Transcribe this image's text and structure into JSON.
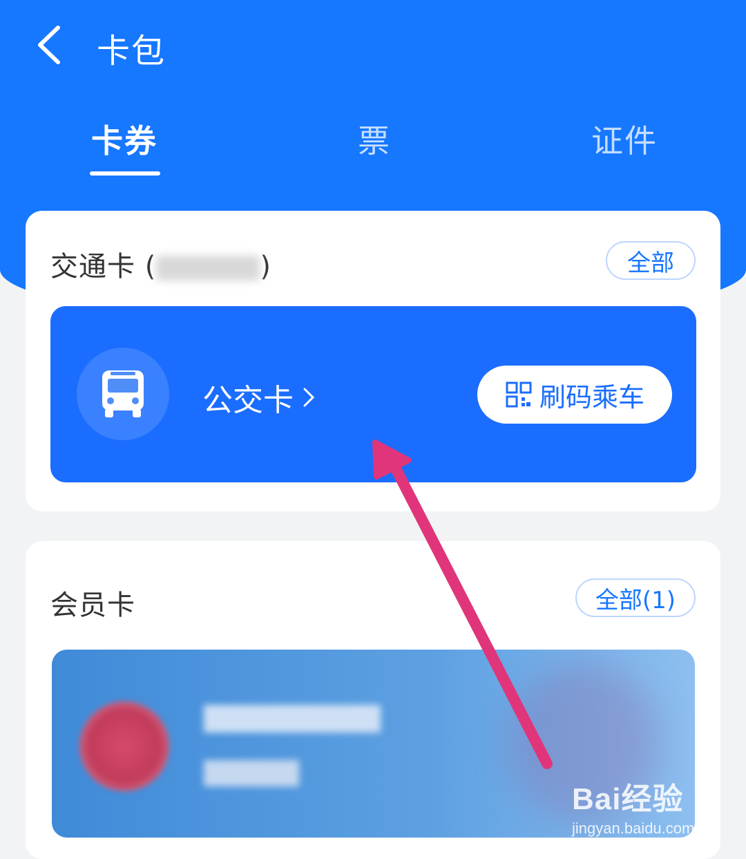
{
  "header": {
    "title": "卡包"
  },
  "tabs": [
    {
      "label": "卡券",
      "active": true
    },
    {
      "label": "票",
      "active": false
    },
    {
      "label": "证件",
      "active": false
    }
  ],
  "transit_section": {
    "title": "交通卡 (",
    "title_suffix": ")",
    "all_label": "全部",
    "card": {
      "label": "公交卡",
      "chevron": "›",
      "ride_button": "刷码乘车",
      "icon": "bus-icon"
    }
  },
  "member_section": {
    "title": "会员卡",
    "all_label": "全部(1)"
  },
  "watermark": {
    "logo": "Bai经验",
    "url": "jingyan.baidu.com"
  },
  "colors": {
    "primary": "#1677ff",
    "card_blue": "#1a6dff",
    "annotation_arrow": "#e0357a"
  }
}
